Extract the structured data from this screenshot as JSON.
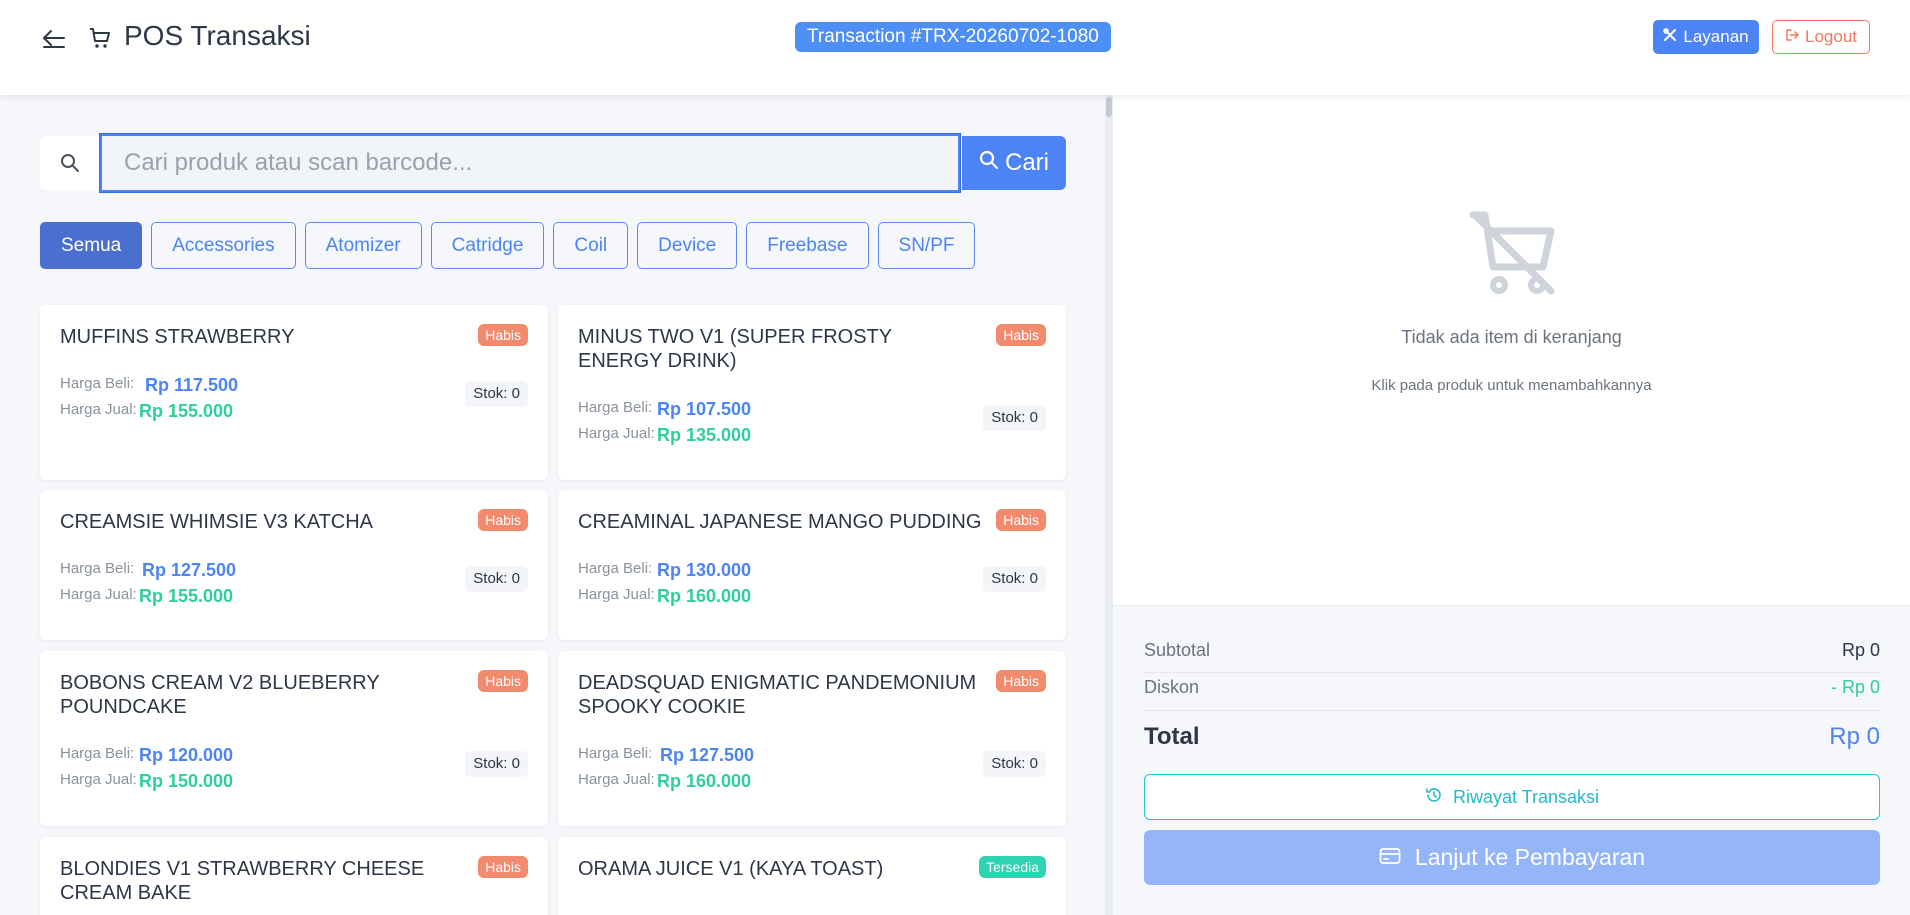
{
  "header": {
    "title": "POS Transaksi",
    "transaction_badge": "Transaction #TRX-20260702-1080",
    "layanan_label": "Layanan",
    "logout_label": "Logout"
  },
  "search": {
    "placeholder": "Cari produk atau scan barcode...",
    "value": "",
    "button_label": "Cari"
  },
  "categories": [
    {
      "label": "Semua",
      "active": true
    },
    {
      "label": "Accessories",
      "active": false
    },
    {
      "label": "Atomizer",
      "active": false
    },
    {
      "label": "Catridge",
      "active": false
    },
    {
      "label": "Coil",
      "active": false
    },
    {
      "label": "Device",
      "active": false
    },
    {
      "label": "Freebase",
      "active": false
    },
    {
      "label": "SN/PF",
      "active": false
    }
  ],
  "products": [
    {
      "name": "MUFFINS STRAWBERRY",
      "status": "Habis",
      "buy_label": "Harga Beli:",
      "buy_price": "Rp 117.500",
      "sell_label": "Harga Jual:",
      "sell_price": "Rp 155.000",
      "stock": "Stok: 0"
    },
    {
      "name": "MINUS TWO V1 (SUPER FROSTY ENERGY DRINK)",
      "status": "Habis",
      "buy_label": "Harga Beli:",
      "buy_price": "Rp 107.500",
      "sell_label": "Harga Jual:",
      "sell_price": "Rp 135.000",
      "stock": "Stok: 0"
    },
    {
      "name": "CREAMSIE WHIMSIE V3 KATCHA",
      "status": "Habis",
      "buy_label": "Harga Beli:",
      "buy_price": "Rp 127.500",
      "sell_label": "Harga Jual:",
      "sell_price": "Rp 155.000",
      "stock": "Stok: 0"
    },
    {
      "name": "CREAMINAL JAPANESE MANGO PUDDING",
      "status": "Habis",
      "buy_label": "Harga Beli:",
      "buy_price": "Rp 130.000",
      "sell_label": "Harga Jual:",
      "sell_price": "Rp 160.000",
      "stock": "Stok: 0"
    },
    {
      "name": "BOBONS CREAM V2 BLUEBERRY POUNDCAKE",
      "status": "Habis",
      "buy_label": "Harga Beli:",
      "buy_price": "Rp 120.000",
      "sell_label": "Harga Jual:",
      "sell_price": "Rp 150.000",
      "stock": "Stok: 0"
    },
    {
      "name": "DEADSQUAD ENIGMATIC PANDEMONIUM SPOOKY COOKIE",
      "status": "Habis",
      "buy_label": "Harga Beli:",
      "buy_price": "Rp 127.500",
      "sell_label": "Harga Jual:",
      "sell_price": "Rp 160.000",
      "stock": "Stok: 0"
    },
    {
      "name": "BLONDIES V1 STRAWBERRY CHEESE CREAM BAKE",
      "status": "Habis"
    },
    {
      "name": "ORAMA JUICE V1 (KAYA TOAST)",
      "status": "Tersedia"
    }
  ],
  "cart": {
    "empty_title": "Tidak ada item di keranjang",
    "empty_subtitle": "Klik pada produk untuk menambahkannya"
  },
  "summary": {
    "subtotal_label": "Subtotal",
    "subtotal_value": "Rp 0",
    "discount_label": "Diskon",
    "discount_value": "- Rp 0",
    "total_label": "Total",
    "total_value": "Rp 0"
  },
  "actions": {
    "history_label": "Riwayat Transaksi",
    "pay_label": "Lanjut ke Pembayaran"
  },
  "colors": {
    "primary": "#4d84f5",
    "success": "#2ecf9f",
    "danger": "#f28a6e",
    "teal": "#26c6da"
  }
}
